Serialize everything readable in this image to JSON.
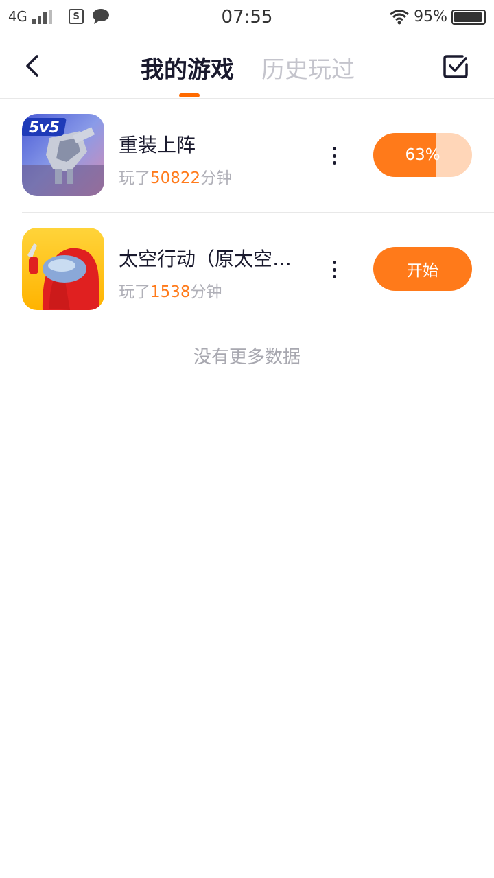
{
  "status_bar": {
    "network": "4G",
    "time": "07:55",
    "battery": "95%",
    "battery_level": 0.95
  },
  "header": {
    "tabs": [
      {
        "label": "我的游戏",
        "active": true
      },
      {
        "label": "历史玩过",
        "active": false
      }
    ],
    "accent_color": "#ff6a00"
  },
  "games": [
    {
      "title": "重装上阵",
      "played_prefix": "玩了",
      "played_minutes": "50822",
      "played_suffix": "分钟",
      "icon": "game-icon-mecha-5v5",
      "icon_badge": "5v5",
      "action_type": "progress",
      "progress_label": "63%",
      "progress": 0.63
    },
    {
      "title": "太空行动（原太空…",
      "played_prefix": "玩了",
      "played_minutes": "1538",
      "played_suffix": "分钟",
      "icon": "game-icon-red-astronaut",
      "action_type": "start",
      "action_label": "开始"
    }
  ],
  "footer_text": "没有更多数据"
}
